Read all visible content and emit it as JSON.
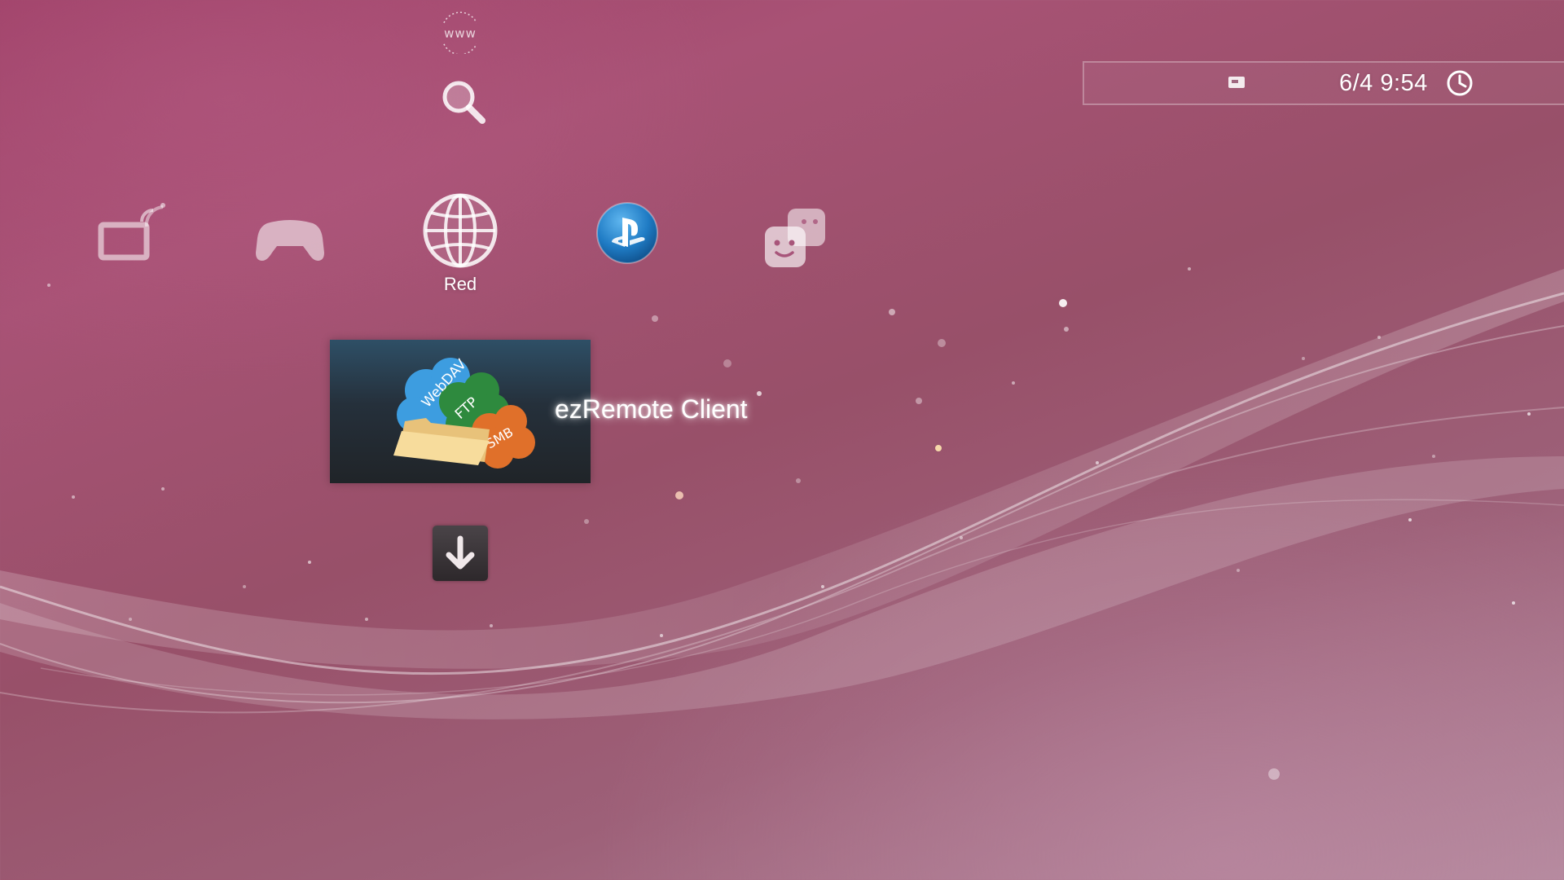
{
  "status_bar": {
    "datetime": "6/4 9:54",
    "storage_icon": "memory-card-icon",
    "clock_icon": "clock-icon"
  },
  "xmb": {
    "categories": [
      {
        "icon": "tv-video-icon"
      },
      {
        "icon": "game-controller-icon"
      },
      {
        "icon": "network-globe-icon",
        "label": "Red"
      },
      {
        "icon": "playstation-network-icon"
      },
      {
        "icon": "friends-icon"
      }
    ],
    "items_above": [
      {
        "icon": "www-icon"
      },
      {
        "icon": "search-icon"
      }
    ],
    "selected_item": {
      "title": "ezRemote Client",
      "thumbnail_texts": [
        "WebDAV",
        "FTP",
        "SMB"
      ]
    },
    "items_below": [
      {
        "icon": "download-arrow-icon"
      }
    ]
  },
  "colors": {
    "background": "#a04a6e",
    "psn_blue": "#1f7bc4",
    "tile_dark": "#25303b",
    "cloud_blue": "#3d9de0",
    "cloud_green": "#2e8a3e",
    "cloud_orange": "#e0702a",
    "folder": "#f2d596"
  }
}
